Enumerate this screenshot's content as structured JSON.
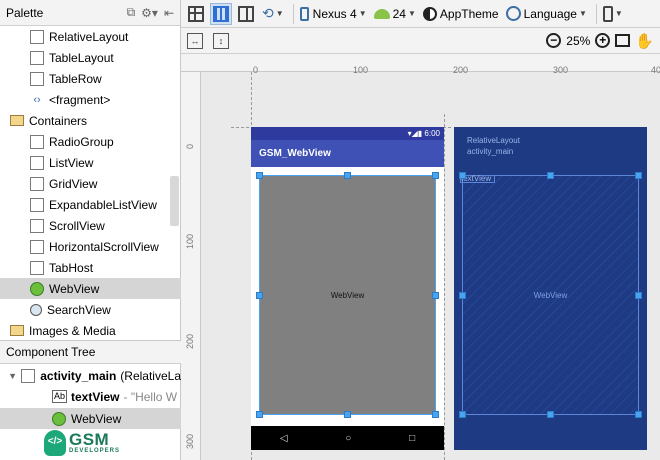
{
  "palette": {
    "title": "Palette",
    "items": [
      {
        "label": "RelativeLayout",
        "icon": "relative-layout-icon"
      },
      {
        "label": "TableLayout",
        "icon": "table-layout-icon"
      },
      {
        "label": "TableRow",
        "icon": "table-row-icon"
      },
      {
        "label": "<fragment>",
        "icon": "fragment-icon"
      },
      {
        "label": "Containers",
        "icon": "folder-icon",
        "category": true
      },
      {
        "label": "RadioGroup",
        "icon": "radio-group-icon"
      },
      {
        "label": "ListView",
        "icon": "list-view-icon"
      },
      {
        "label": "GridView",
        "icon": "grid-view-icon"
      },
      {
        "label": "ExpandableListView",
        "icon": "expandable-list-view-icon"
      },
      {
        "label": "ScrollView",
        "icon": "scroll-view-icon"
      },
      {
        "label": "HorizontalScrollView",
        "icon": "horizontal-scroll-view-icon"
      },
      {
        "label": "TabHost",
        "icon": "tab-host-icon"
      },
      {
        "label": "WebView",
        "icon": "webview-globe-icon",
        "selected": true
      },
      {
        "label": "SearchView",
        "icon": "search-view-icon"
      },
      {
        "label": "Images & Media",
        "icon": "folder-icon",
        "category": true
      }
    ]
  },
  "component_tree": {
    "title": "Component Tree",
    "root": {
      "name": "activity_main",
      "type": "(RelativeLa"
    },
    "children": [
      {
        "name": "textView",
        "detail": "- \"Hello W",
        "badge": "Ab"
      },
      {
        "name": "WebView",
        "detail": "",
        "selected": true
      }
    ]
  },
  "toolbar": {
    "device": "Nexus 4",
    "api": "24",
    "theme": "AppTheme",
    "language": "Language"
  },
  "zoom": {
    "level": "25%"
  },
  "ruler": {
    "top": [
      "0",
      "100",
      "200",
      "300",
      "40"
    ],
    "left": [
      "0",
      "100",
      "200",
      "300"
    ]
  },
  "design": {
    "status_time": "6:00",
    "app_title": "GSM_WebView",
    "webview_label": "WebView"
  },
  "blueprint": {
    "layout_label": "RelativeLayout",
    "activity_label": "activity_main",
    "textview_label": "textView",
    "webview_label": "WebView"
  },
  "logo": {
    "brand": "GSM",
    "sub": "DEVELOPERS"
  }
}
